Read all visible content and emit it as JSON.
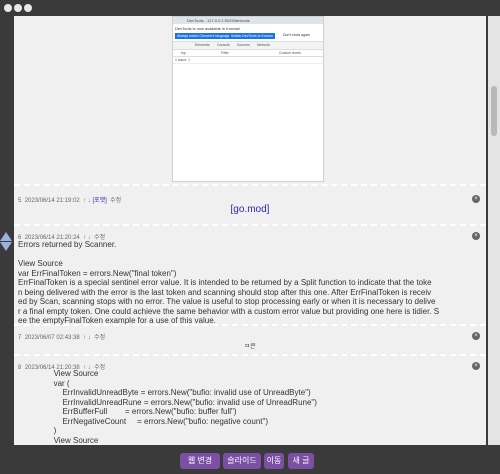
{
  "colors": {
    "accent": "#7b4fa3",
    "link": "#2a2ab0",
    "panel": "#f0f0f0",
    "chrome": "#3a3a3a"
  },
  "screenshot": {
    "title": "DevTools - 127.0.0.1:9229/devtools",
    "notice": "DevTools is now available in Korean!",
    "btn_match": "Always match Chrome's language",
    "btn_switch": "Switch DevTools to Korean",
    "btn_dont": "Don't show again",
    "tabs": [
      "Elements",
      "Console",
      "Sources",
      "Network"
    ],
    "filter_left": "top",
    "filter_mid": "Filter",
    "filter_right": "Custom levels",
    "issues": "1 Issue:",
    "issues_count": "1"
  },
  "posts": [
    {
      "num": "5",
      "date": "2023/06/14 21:19:02",
      "arrows": "↑ ↓",
      "tag": "[포맷]",
      "edit": "수정",
      "link": "[go.mod]"
    },
    {
      "num": "6",
      "date": "2023/06/14 21:20:24",
      "arrows": "↑ ↓",
      "edit": "수정",
      "body": "Errors returned by Scanner.\n\nView Source\nvar ErrFinalToken = errors.New(\"final token\")\nErrFinalToken is a special sentinel error value. It is intended to be returned by a Split function to indicate that the toke\nn being delivered with the error is the last token and scanning should stop after this one. After ErrFinalToken is receiv\ned by Scan, scanning stops with no error. The value is useful to stop processing early or when it is necessary to delive\nr a final empty token. One could achieve the same behavior with a custom error value but providing one here is tidier. S\nee the emptyFinalToken example for a use of this value."
    },
    {
      "num": "7",
      "date": "2023/06/07 02:43:38",
      "arrows": "↑ ↓",
      "edit": "수정",
      "body": "ㅁ큰"
    },
    {
      "num": "8",
      "date": "2023/06/14 21:20:38",
      "arrows": "↑ ↓",
      "edit": "수정",
      "body": "                View Source\n                var (\n                    ErrInvalidUnreadByte = errors.New(\"bufio: invalid use of UnreadByte\")\n                    ErrInvalidUnreadRune = errors.New(\"bufio: invalid use of UnreadRune\")\n                    ErrBufferFull        = errors.New(\"bufio: buffer full\")\n                    ErrNegativeCount     = errors.New(\"bufio: negative count\")\n                )\n                View Source\n                var ("
    }
  ],
  "close_glyph": "×",
  "bottom": {
    "b1": "웹 변경",
    "b2": "슬라이드",
    "b3": "이동",
    "b4": "새 글"
  }
}
